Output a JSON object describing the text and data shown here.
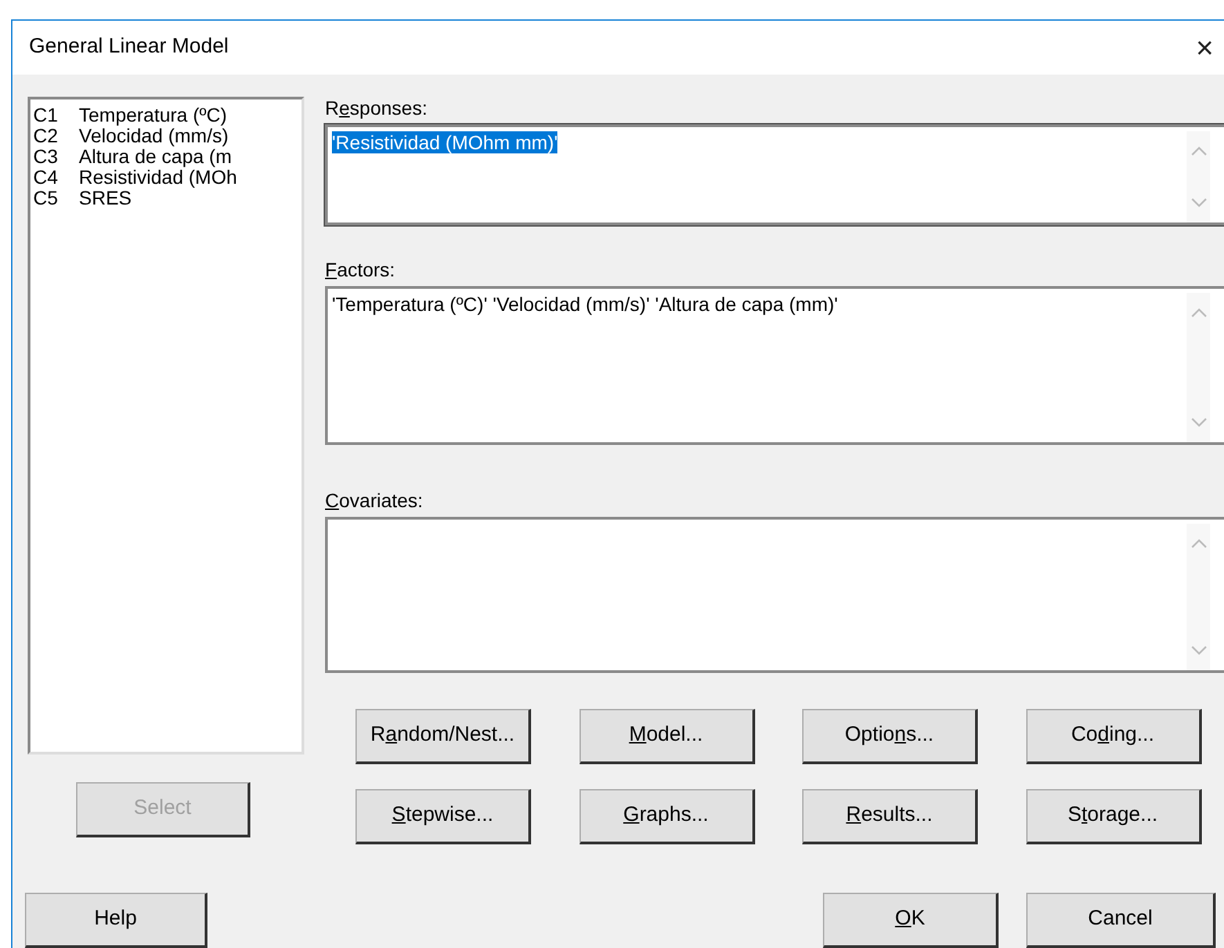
{
  "window": {
    "title": "General Linear Model",
    "close": "×"
  },
  "columns": [
    {
      "id": "C1",
      "name": "Temperatura (ºC)"
    },
    {
      "id": "C2",
      "name": "Velocidad (mm/s)"
    },
    {
      "id": "C3",
      "name": "Altura de capa (m"
    },
    {
      "id": "C4",
      "name": "Resistividad (MOh"
    },
    {
      "id": "C5",
      "name": "SRES"
    }
  ],
  "fields": [
    {
      "label": [
        {
          "text": "R",
          "underlined": false
        },
        {
          "text": "e",
          "underlined": true
        },
        {
          "text": "sponses:",
          "underlined": false
        }
      ],
      "value": "'Resistividad (MOhm mm)'",
      "selected": true
    },
    {
      "label": [
        {
          "text": "F",
          "underlined": true
        },
        {
          "text": "actors:",
          "underlined": false
        }
      ],
      "value": "'Temperatura (ºC)' 'Velocidad (mm/s)' 'Altura de capa (mm)'",
      "selected": false
    },
    {
      "label": [
        {
          "text": "C",
          "underlined": true
        },
        {
          "text": "ovariates:",
          "underlined": false
        }
      ],
      "selected": false
    }
  ],
  "select_button": {
    "label": [
      {
        "text": "Select",
        "underlined": false
      }
    ],
    "disabled": true
  },
  "option_buttons": [
    {
      "label": [
        {
          "text": "R",
          "underlined": false
        },
        {
          "text": "a",
          "underlined": true
        },
        {
          "text": "ndom/Nest...",
          "underlined": false
        }
      ]
    },
    {
      "label": [
        {
          "text": "M",
          "underlined": true
        },
        {
          "text": "odel...",
          "underlined": false
        }
      ]
    },
    {
      "label": [
        {
          "text": "Optio",
          "underlined": false
        },
        {
          "text": "n",
          "underlined": true
        },
        {
          "text": "s...",
          "underlined": false
        }
      ]
    },
    {
      "label": [
        {
          "text": "Co",
          "underlined": false
        },
        {
          "text": "d",
          "underlined": true
        },
        {
          "text": "ing...",
          "underlined": false
        }
      ]
    },
    {
      "label": [
        {
          "text": "S",
          "underlined": true
        },
        {
          "text": "tepwise...",
          "underlined": false
        }
      ]
    },
    {
      "label": [
        {
          "text": "G",
          "underlined": true
        },
        {
          "text": "raphs...",
          "underlined": false
        }
      ]
    },
    {
      "label": [
        {
          "text": "R",
          "underlined": true
        },
        {
          "text": "esults...",
          "underlined": false
        }
      ]
    },
    {
      "label": [
        {
          "text": "S",
          "underlined": false
        },
        {
          "text": "t",
          "underlined": true
        },
        {
          "text": "orage...",
          "underlined": false
        }
      ]
    }
  ],
  "help_button": {
    "label": [
      {
        "text": "Help",
        "underlined": false
      }
    ]
  },
  "ok_button": {
    "label": [
      {
        "text": "O",
        "underlined": true
      },
      {
        "text": "K",
        "underlined": false
      }
    ]
  },
  "cancel_button": {
    "label": [
      {
        "text": "Cancel",
        "underlined": false
      }
    ]
  }
}
